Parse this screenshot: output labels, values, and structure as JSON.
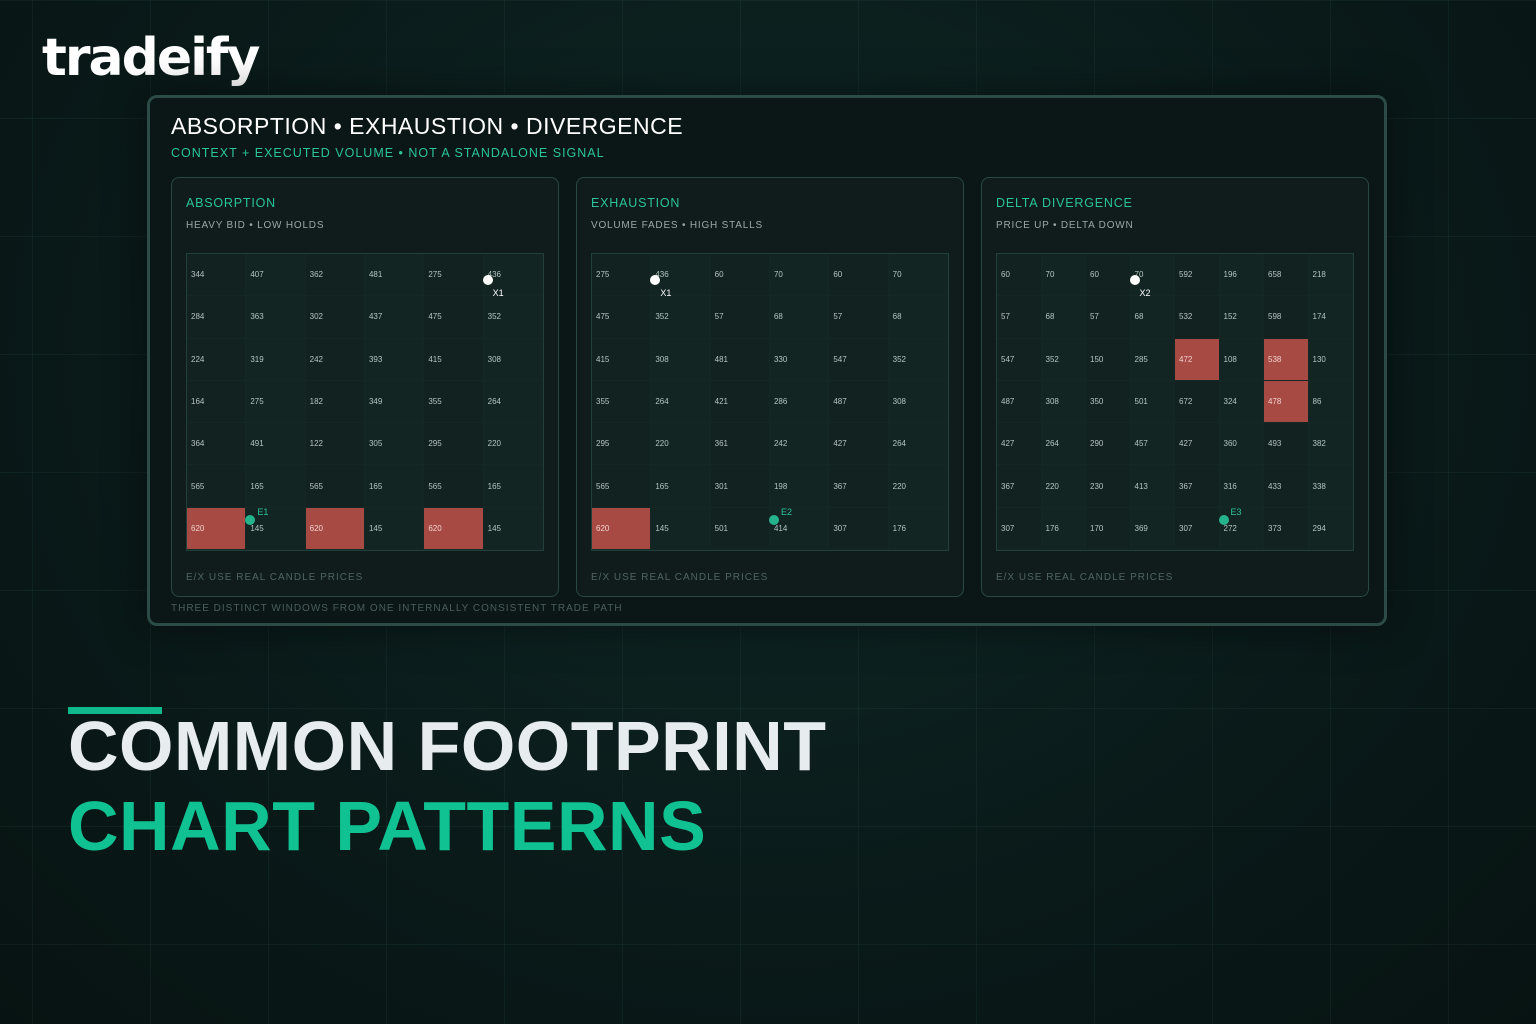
{
  "brand": {
    "logo_text": "tradeify"
  },
  "panel": {
    "title": "ABSORPTION • EXHAUSTION • DIVERGENCE",
    "subtitle": "CONTEXT + EXECUTED VOLUME • NOT A STANDALONE SIGNAL",
    "footer": "THREE DISTINCT WINDOWS FROM ONE INTERNALLY CONSISTENT TRADE PATH",
    "sections": [
      {
        "title": "ABSORPTION",
        "subtitle": "HEAVY BID • LOW HOLDS",
        "footer": "E/X USE REAL CANDLE PRICES",
        "columns": 6,
        "rows": [
          [
            "344",
            "407",
            "362",
            "481",
            "275",
            "436"
          ],
          [
            "284",
            "363",
            "302",
            "437",
            "475",
            "352"
          ],
          [
            "224",
            "319",
            "242",
            "393",
            "415",
            "308"
          ],
          [
            "164",
            "275",
            "182",
            "349",
            "355",
            "264"
          ],
          [
            "364",
            "491",
            "122",
            "305",
            "295",
            "220"
          ],
          [
            "565",
            "165",
            "565",
            "165",
            "565",
            "165"
          ],
          [
            "620",
            "145",
            "620",
            "145",
            "620",
            "145"
          ]
        ],
        "highlighted": [
          [
            6,
            0
          ],
          [
            6,
            2
          ],
          [
            6,
            4
          ]
        ],
        "markers": [
          {
            "label": "X1",
            "color": "white",
            "row": 0,
            "col": 5
          },
          {
            "label": "E1",
            "color": "green",
            "row": 6,
            "col": 1
          }
        ]
      },
      {
        "title": "EXHAUSTION",
        "subtitle": "VOLUME FADES • HIGH STALLS",
        "footer": "E/X USE REAL CANDLE PRICES",
        "columns": 6,
        "rows": [
          [
            "275",
            "436",
            "60",
            "70",
            "60",
            "70"
          ],
          [
            "475",
            "352",
            "57",
            "68",
            "57",
            "68"
          ],
          [
            "415",
            "308",
            "481",
            "330",
            "547",
            "352"
          ],
          [
            "355",
            "264",
            "421",
            "286",
            "487",
            "308"
          ],
          [
            "295",
            "220",
            "361",
            "242",
            "427",
            "264"
          ],
          [
            "565",
            "165",
            "301",
            "198",
            "367",
            "220"
          ],
          [
            "620",
            "145",
            "501",
            "414",
            "307",
            "176"
          ]
        ],
        "highlighted": [
          [
            6,
            0
          ]
        ],
        "markers": [
          {
            "label": "X1",
            "color": "white",
            "row": 0,
            "col": 1
          },
          {
            "label": "E2",
            "color": "green",
            "row": 6,
            "col": 3
          }
        ]
      },
      {
        "title": "DELTA DIVERGENCE",
        "subtitle": "PRICE UP • DELTA DOWN",
        "footer": "E/X USE REAL CANDLE PRICES",
        "columns": 8,
        "rows": [
          [
            "60",
            "70",
            "60",
            "70",
            "592",
            "196",
            "658",
            "218"
          ],
          [
            "57",
            "68",
            "57",
            "68",
            "532",
            "152",
            "598",
            "174"
          ],
          [
            "547",
            "352",
            "150",
            "285",
            "472",
            "108",
            "538",
            "130"
          ],
          [
            "487",
            "308",
            "350",
            "501",
            "672",
            "324",
            "478",
            "86"
          ],
          [
            "427",
            "264",
            "290",
            "457",
            "427",
            "360",
            "493",
            "382"
          ],
          [
            "367",
            "220",
            "230",
            "413",
            "367",
            "316",
            "433",
            "338"
          ],
          [
            "307",
            "176",
            "170",
            "369",
            "307",
            "272",
            "373",
            "294"
          ]
        ],
        "highlighted": [
          [
            2,
            4
          ],
          [
            2,
            6
          ],
          [
            3,
            6
          ]
        ],
        "markers": [
          {
            "label": "X2",
            "color": "white",
            "row": 0,
            "col": 3
          },
          {
            "label": "E3",
            "color": "green",
            "row": 6,
            "col": 5
          }
        ]
      }
    ]
  },
  "headline": {
    "line1": "COMMON FOOTPRINT",
    "line2": "CHART PATTERNS"
  },
  "colors": {
    "accent": "#10c191",
    "highlight_cell": "#a84a44",
    "background": "#0a1b1a"
  }
}
